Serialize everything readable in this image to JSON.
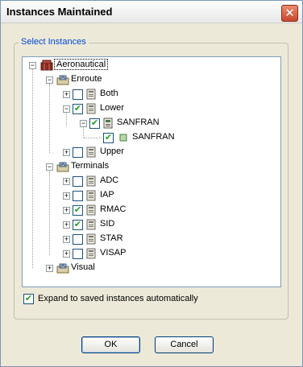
{
  "window": {
    "title": "Instances Maintained",
    "close_glyph": "✕"
  },
  "group": {
    "legend": "Select Instances"
  },
  "tree": {
    "root": {
      "label": "Aeronautical",
      "icon": "aeronautical-icon",
      "expander": "−"
    },
    "enroute": {
      "label": "Enroute",
      "icon": "folder-map-icon",
      "expander": "−"
    },
    "both": {
      "label": "Both",
      "checked": false,
      "expander": "+"
    },
    "lower": {
      "label": "Lower",
      "checked": true,
      "expander": "−"
    },
    "sanfran_parent": {
      "label": "SANFRAN",
      "checked": true,
      "expander": "−"
    },
    "sanfran_child": {
      "label": "SANFRAN",
      "checked": true
    },
    "upper": {
      "label": "Upper",
      "checked": false,
      "expander": "+"
    },
    "terminals": {
      "label": "Terminals",
      "icon": "folder-map-icon",
      "expander": "−"
    },
    "adc": {
      "label": "ADC",
      "checked": false,
      "expander": "+"
    },
    "iap": {
      "label": "IAP",
      "checked": false,
      "expander": "+"
    },
    "rmac": {
      "label": "RMAC",
      "checked": true,
      "expander": "+"
    },
    "sid": {
      "label": "SID",
      "checked": true,
      "expander": "+"
    },
    "star": {
      "label": "STAR",
      "checked": false,
      "expander": "+"
    },
    "visap": {
      "label": "VISAP",
      "checked": false,
      "expander": "+"
    },
    "visual": {
      "label": "Visual",
      "icon": "folder-map-icon",
      "expander": "+"
    }
  },
  "expand_option": {
    "label": "Expand to saved instances automatically",
    "checked": true
  },
  "buttons": {
    "ok": "OK",
    "cancel": "Cancel"
  },
  "check_glyph": "✔",
  "colors": {
    "check": "#21a121",
    "legend": "#0046d5"
  }
}
